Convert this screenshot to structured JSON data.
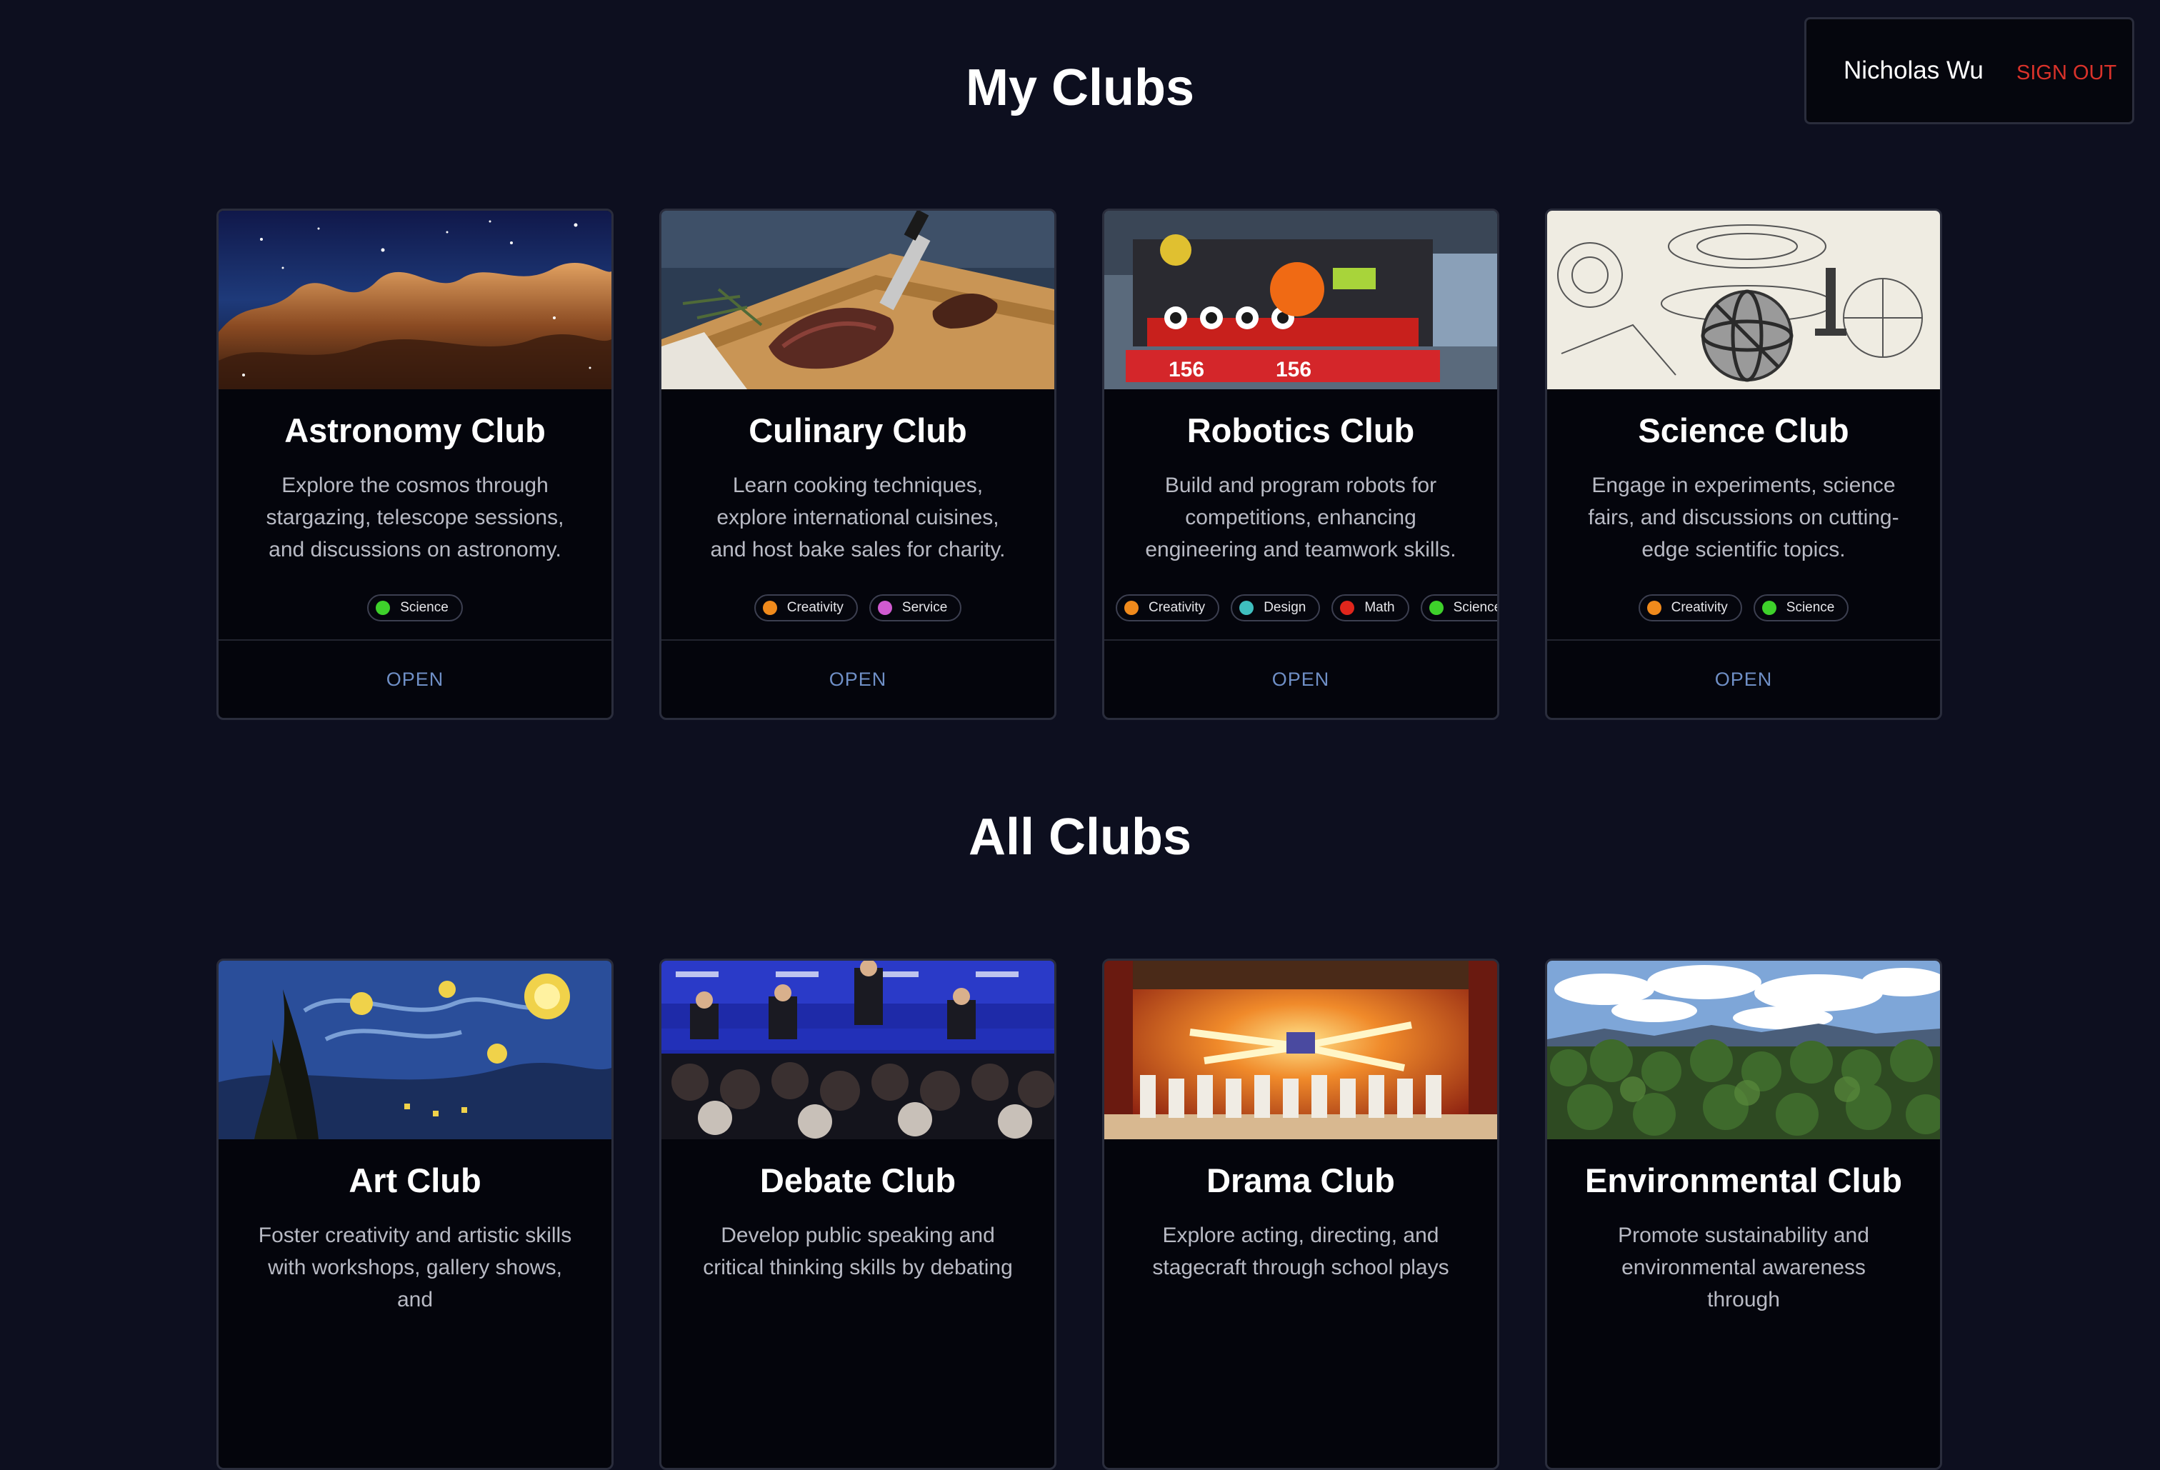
{
  "user": {
    "name": "Nicholas Wu",
    "sign_out_label": "SIGN OUT"
  },
  "sections": {
    "my_clubs_title": "My Clubs",
    "all_clubs_title": "All Clubs"
  },
  "tag_colors": {
    "Science": "#3ed12b",
    "Creativity": "#f08a1c",
    "Service": "#d05ad0",
    "Design": "#3fbfbf",
    "Math": "#e0261c"
  },
  "my_clubs": [
    {
      "title": "Astronomy Club",
      "description": "Explore the cosmos through stargazing, telescope sessions, and discussions on astronomy.",
      "tags": [
        "Science"
      ],
      "open_label": "OPEN",
      "image": "nebula-image"
    },
    {
      "title": "Culinary Club",
      "description": "Learn cooking techniques, explore international cuisines, and host bake sales for charity.",
      "tags": [
        "Creativity",
        "Service"
      ],
      "open_label": "OPEN",
      "image": "steak-image"
    },
    {
      "title": "Robotics Club",
      "description": "Build and program robots for competitions, enhancing engineering and teamwork skills.",
      "tags": [
        "Creativity",
        "Design",
        "Math",
        "Science"
      ],
      "open_label": "OPEN",
      "image": "robot-image"
    },
    {
      "title": "Science Club",
      "description": "Engage in experiments, science fairs, and discussions on cutting-edge scientific topics.",
      "tags": [
        "Creativity",
        "Science"
      ],
      "open_label": "OPEN",
      "image": "sketch-image"
    }
  ],
  "all_clubs": [
    {
      "title": "Art Club",
      "description": "Foster creativity and artistic skills with workshops, gallery shows, and",
      "image": "starry-night-image"
    },
    {
      "title": "Debate Club",
      "description": "Develop public speaking and critical thinking skills by debating",
      "image": "debate-image"
    },
    {
      "title": "Drama Club",
      "description": "Explore acting, directing, and stagecraft through school plays",
      "image": "stage-image"
    },
    {
      "title": "Environmental Club",
      "description": "Promote sustainability and environmental awareness through",
      "image": "forest-image"
    }
  ]
}
